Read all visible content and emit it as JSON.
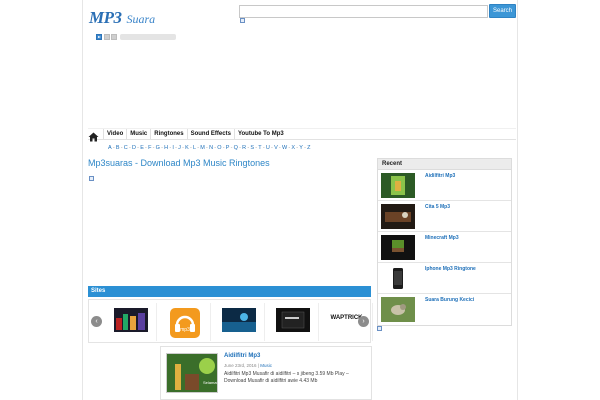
{
  "header": {
    "logo_main": "MP3",
    "logo_sub": "Suara",
    "search": {
      "button_label": "Search",
      "placeholder": ""
    }
  },
  "nav": {
    "items": [
      "Video",
      "Music",
      "Ringtones",
      "Sound Effects",
      "Youtube To Mp3"
    ]
  },
  "alphabet": [
    "A",
    "B",
    "C",
    "D",
    "E",
    "F",
    "G",
    "H",
    "I",
    "J",
    "K",
    "L",
    "M",
    "N",
    "O",
    "P",
    "Q",
    "R",
    "S",
    "T",
    "U",
    "V",
    "W",
    "X",
    "Y",
    "Z"
  ],
  "main": {
    "title": "Mp3suaras - Download Mp3 Music Ringtones"
  },
  "sites": {
    "label": "Sites",
    "slide_labels": [
      "",
      "",
      "",
      "",
      "WAPTRICK"
    ]
  },
  "post": {
    "title": "Aidilfitri Mp3",
    "date": "June 23rd, 2016",
    "category": "Music",
    "excerpt": "Aidilfitri Mp3 Musafir di aidilfitri – s jibeng 3.59 Mb Play – Download Musafir di aidilfitri awie 4.43 Mb"
  },
  "sidebar": {
    "recent_label": "Recent",
    "items": [
      {
        "title": "Aidilfitri Mp3"
      },
      {
        "title": "Cita 5 Mp3"
      },
      {
        "title": "Minecraft Mp3"
      },
      {
        "title": "Iphone Mp3 Ringtone"
      },
      {
        "title": "Suara Burung Kecici"
      }
    ]
  },
  "colors": {
    "accent": "#2b90d4",
    "link": "#1d6fb8",
    "title": "#2d86c7"
  }
}
